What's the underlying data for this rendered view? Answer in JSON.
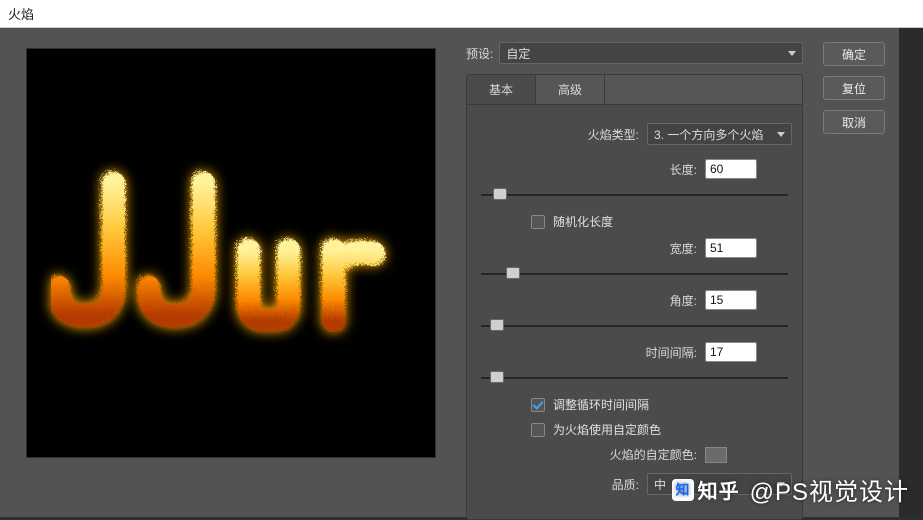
{
  "dialog": {
    "title": "火焰",
    "preset_label": "预设:",
    "preset_value": "自定",
    "tabs": {
      "basic": "基本",
      "advanced": "高级",
      "active": "basic"
    },
    "fields": {
      "flame_type_label": "火焰类型:",
      "flame_type_value": "3. 一个方向多个火焰",
      "length_label": "长度:",
      "length_value": "60",
      "randomize_length_label": "随机化长度",
      "randomize_length_checked": false,
      "width_label": "宽度:",
      "width_value": "51",
      "angle_label": "角度:",
      "angle_value": "15",
      "interval_label": "时间间隔:",
      "interval_value": "17",
      "adjust_loop_interval_label": "调整循环时间间隔",
      "adjust_loop_interval_checked": true,
      "use_custom_color_label": "为火焰使用自定颜色",
      "use_custom_color_checked": false,
      "custom_color_label": "火焰的自定颜色:",
      "quality_label": "品质:",
      "quality_value": "中"
    },
    "buttons": {
      "ok": "确定",
      "reset": "复位",
      "cancel": "取消"
    }
  },
  "preview": {
    "text_rendered": "JJur"
  },
  "watermark": {
    "zhihu_label": "知乎",
    "handle": "@PS视觉设计"
  },
  "colors": {
    "flame_light": "#ffd55a",
    "flame_dark": "#c85a00",
    "panel": "#535353"
  }
}
